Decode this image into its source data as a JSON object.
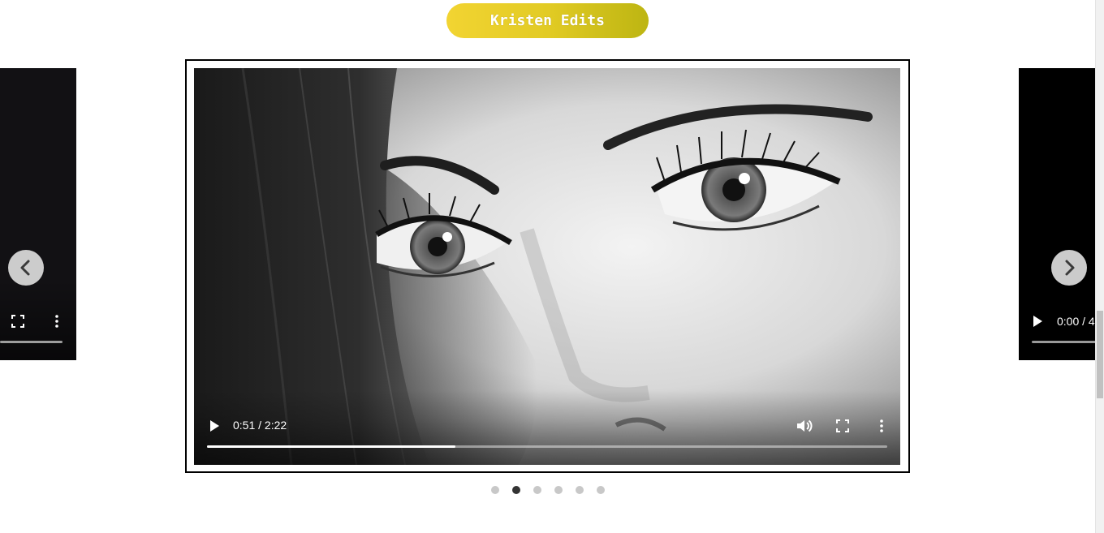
{
  "header": {
    "title": "Kristen Edits"
  },
  "main_video": {
    "current_time": "0:51 / 2:22",
    "progress_fraction": 0.365
  },
  "right_video": {
    "current_time": "0:00 / 4"
  },
  "carousel": {
    "slide_count": 6,
    "active_index": 1
  },
  "colors": {
    "title_gradient_start": "#f2d432",
    "title_gradient_end": "#bdb512",
    "active_dot": "#333333",
    "inactive_dot": "#c8c8c8"
  },
  "icons": {
    "prev": "chevron-left-icon",
    "next": "chevron-right-icon",
    "play": "play-icon",
    "volume": "volume-icon",
    "fullscreen": "fullscreen-icon",
    "more": "more-vertical-icon"
  }
}
